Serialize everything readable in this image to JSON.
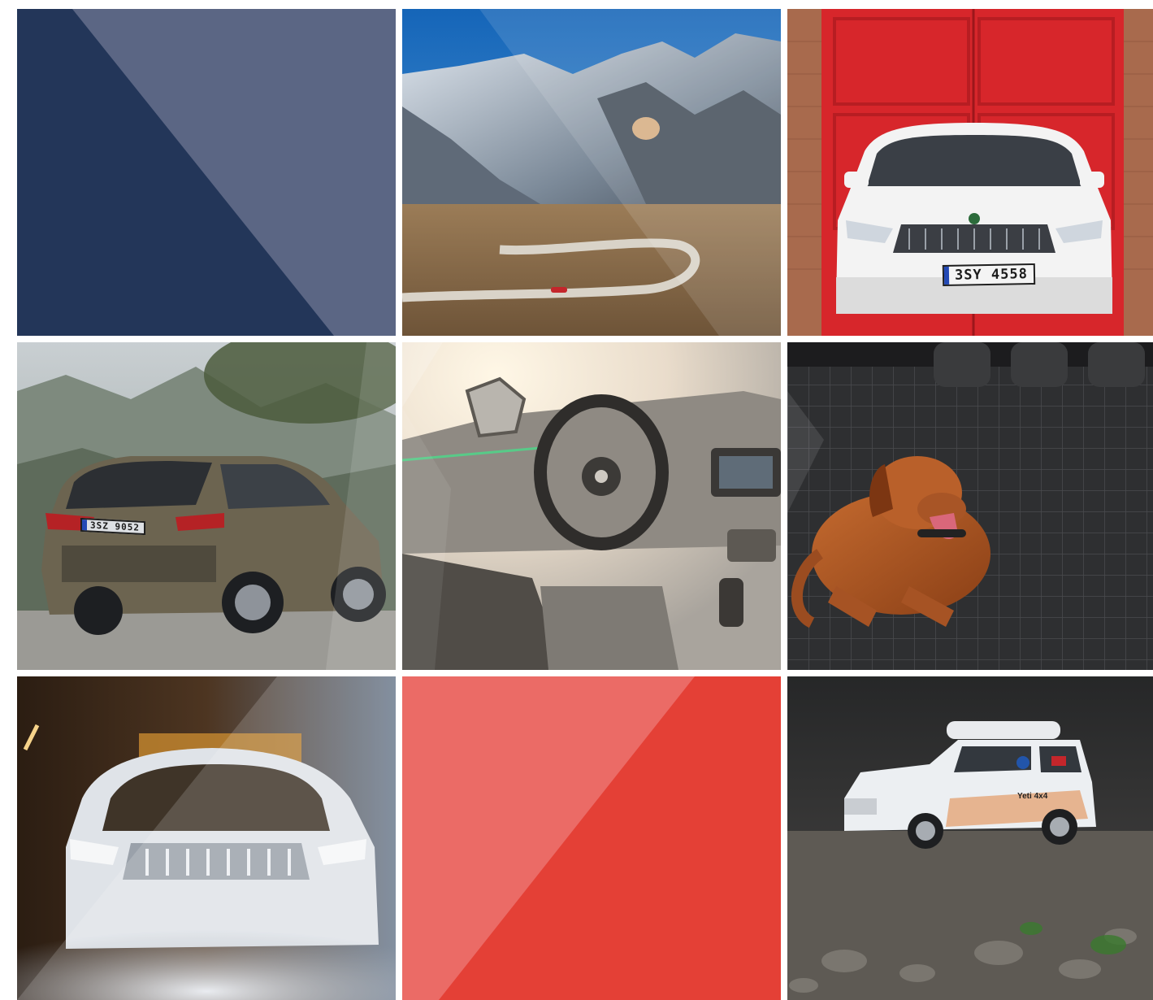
{
  "tiles": [
    {
      "name": "navy-diagonal-panel",
      "colors": {
        "base": "#233659",
        "overlay": "#5b6684"
      }
    },
    {
      "name": "mountain-road-photo"
    },
    {
      "name": "red-door-kodiaq-photo",
      "license_plate": "3SY 4558"
    },
    {
      "name": "olive-tree-kodiaq-rear-photo",
      "license_plate": "3SZ 9052"
    },
    {
      "name": "interior-dashboard-photo"
    },
    {
      "name": "dog-seat-cover-photo"
    },
    {
      "name": "smoke-kodiaq-photo"
    },
    {
      "name": "red-diagonal-panel",
      "colors": {
        "base": "#e44036",
        "overlay": "#eb6b66"
      }
    },
    {
      "name": "yeti-rally-car-photo",
      "decals": [
        "Yeti 4x4"
      ]
    }
  ],
  "colors": {
    "navy": "#233659",
    "slate": "#5b6684",
    "red": "#e44036",
    "salmon": "#eb6b66",
    "door_red": "#d7262b"
  }
}
